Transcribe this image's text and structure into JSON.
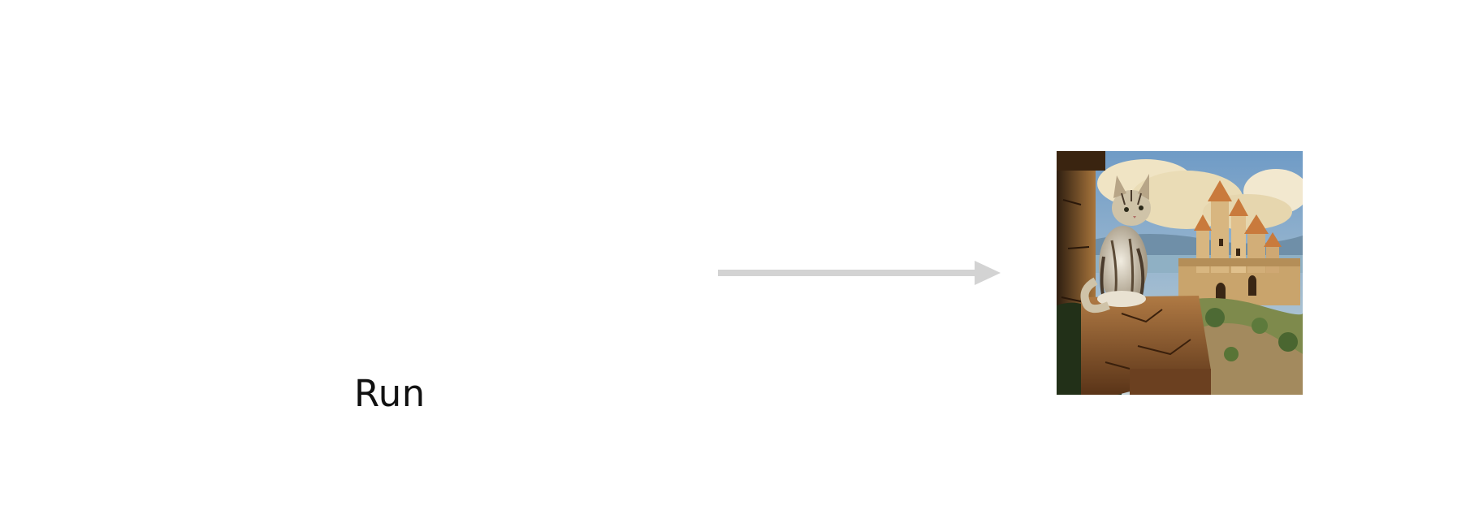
{
  "diagram": {
    "input_label": "Run",
    "output_image": {
      "subject": "cat-and-castle-painting",
      "colors": {
        "sky": "#7aa2c8",
        "cloud": "#efe2c0",
        "castle": "#d8b680",
        "roof": "#c97a3c",
        "stone": "#8a5a2c",
        "cat_fur": "#cfc3a8",
        "cat_stripe": "#4a3b2c",
        "foliage": "#4d6a34"
      }
    },
    "arrow": {
      "color": "#d3d3d3"
    }
  }
}
